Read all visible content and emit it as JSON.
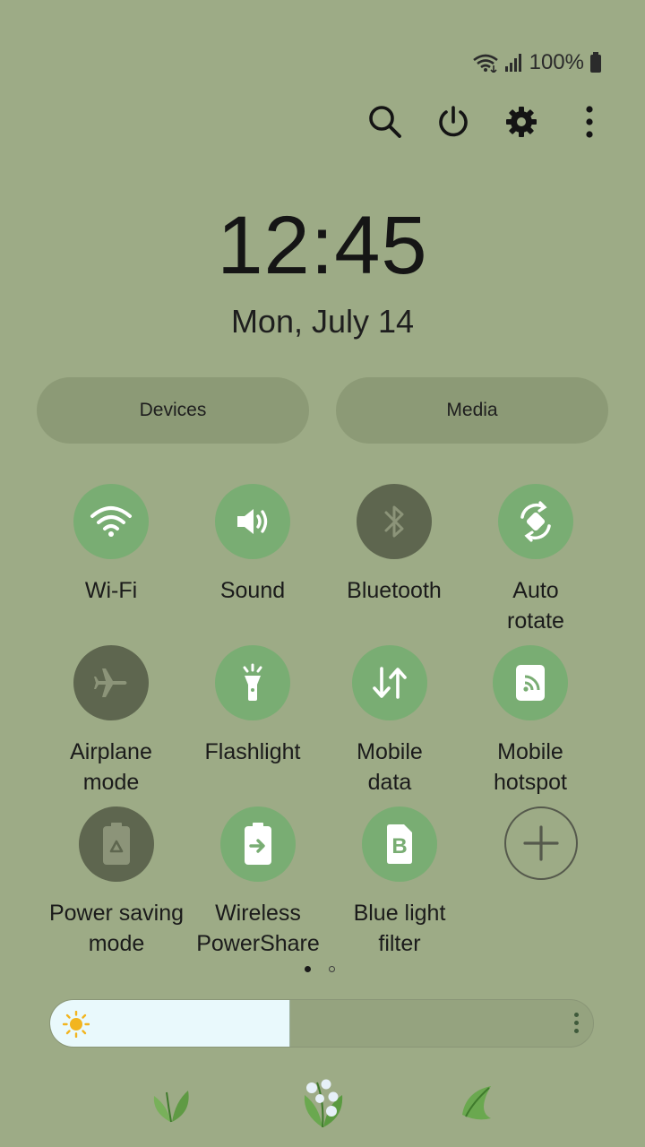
{
  "status": {
    "battery_text": "100%",
    "icons": [
      "wifi-icon",
      "signal-icon",
      "battery-icon"
    ]
  },
  "top_actions": [
    {
      "name": "search-icon"
    },
    {
      "name": "power-icon"
    },
    {
      "name": "settings-icon"
    },
    {
      "name": "more-options-icon"
    }
  ],
  "clock": {
    "time": "12:45",
    "date": "Mon, July 14"
  },
  "buttons": {
    "devices": "Devices",
    "media": "Media"
  },
  "tiles": [
    {
      "label": "Wi-Fi",
      "icon": "wifi-icon",
      "on": true
    },
    {
      "label": "Sound",
      "icon": "sound-icon",
      "on": true
    },
    {
      "label": "Bluetooth",
      "icon": "bluetooth-icon",
      "on": false
    },
    {
      "label": "Auto\nrotate",
      "icon": "auto-rotate-icon",
      "on": true
    },
    {
      "label": "Airplane\nmode",
      "icon": "airplane-icon",
      "on": false
    },
    {
      "label": "Flashlight",
      "icon": "flashlight-icon",
      "on": true
    },
    {
      "label": "Mobile\ndata",
      "icon": "mobile-data-icon",
      "on": true
    },
    {
      "label": "Mobile\nhotspot",
      "icon": "hotspot-icon",
      "on": true
    },
    {
      "label": "Power saving\nmode",
      "icon": "power-saving-icon",
      "on": false
    },
    {
      "label": "Wireless\nPowerShare",
      "icon": "wireless-powershare-icon",
      "on": true
    },
    {
      "label": "Blue light\nfilter",
      "icon": "blue-light-filter-icon",
      "on": true
    },
    {
      "label": "",
      "icon": "add-tile-icon",
      "on": null
    }
  ],
  "pager": {
    "pages": 2,
    "current": 1
  },
  "brightness": {
    "level": 0.44
  },
  "colors": {
    "background": "#9dab86",
    "tile_on": "#79ad73",
    "tile_off": "#5e664f",
    "pill": "#8c9a76",
    "brightness_fill": "#e9f9fc"
  }
}
